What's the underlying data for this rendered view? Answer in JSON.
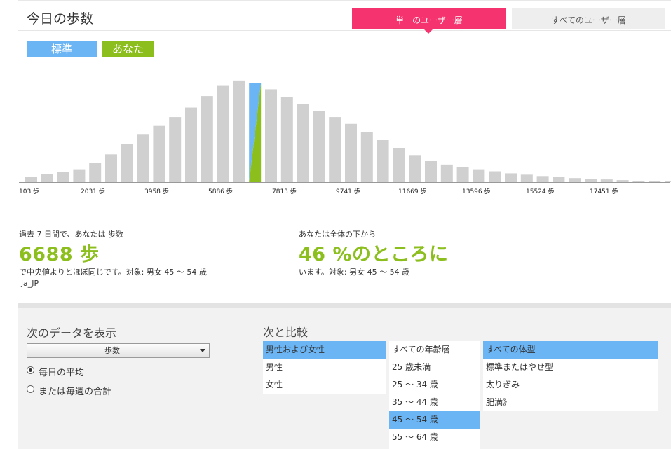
{
  "header": {
    "title": "今日の歩数",
    "tabs": [
      {
        "label": "単一のユーザー層",
        "active": true
      },
      {
        "label": "すべてのユーザー層",
        "active": false
      }
    ]
  },
  "legend": {
    "standard": "標準",
    "you": "あなた"
  },
  "colors": {
    "accent_pink": "#f5336e",
    "standard_blue": "#6bb5f5",
    "you_green": "#8cbf1e",
    "bar_gray": "#d0d0d0"
  },
  "chart_data": {
    "type": "bar",
    "title": "",
    "xlabel": "",
    "ylabel": "",
    "x_ticks": [
      "103 歩",
      "2031 歩",
      "3958 歩",
      "5886 歩",
      "7813 歩",
      "9741 歩",
      "11669 歩",
      "13596 歩",
      "15524 歩",
      "17451 歩"
    ],
    "values": [
      8,
      12,
      15,
      19,
      28,
      41,
      56,
      70,
      83,
      96,
      110,
      127,
      142,
      150,
      146,
      137,
      126,
      115,
      105,
      96,
      86,
      74,
      62,
      50,
      40,
      31,
      26,
      22,
      19,
      16,
      13,
      11,
      9,
      8,
      6,
      5,
      4,
      3,
      2,
      2,
      1
    ],
    "highlight_index": 14,
    "ylim": [
      0,
      155
    ]
  },
  "stats": {
    "left": {
      "label": "過去 7 日間で、あなたは 歩数",
      "value": "6688 歩",
      "note": "で中央値よりとほぼ同じです。対象: 男女 45 ～ 54 歳",
      "locale": "ja_JP"
    },
    "right": {
      "label": "あなたは全体の下から",
      "value": "46 %のところに",
      "note": "います。対象: 男女 45 ～ 54 歳"
    }
  },
  "display_panel": {
    "title": "次のデータを表示",
    "metric_selected": "歩数",
    "radio_options": [
      {
        "label": "毎日の平均",
        "checked": true
      },
      {
        "label": "または毎週の合計",
        "checked": false
      }
    ]
  },
  "compare_panel": {
    "title": "次と比較",
    "gender": [
      {
        "label": "男性および女性",
        "selected": true
      },
      {
        "label": "男性",
        "selected": false
      },
      {
        "label": "女性",
        "selected": false
      }
    ],
    "age": [
      {
        "label": "すべての年齢層",
        "selected": false
      },
      {
        "label": "25 歳未満",
        "selected": false
      },
      {
        "label": "25 ～ 34 歳",
        "selected": false
      },
      {
        "label": "35 ～ 44 歳",
        "selected": false
      },
      {
        "label": "45 ～ 54 歳",
        "selected": true
      },
      {
        "label": "55 ～ 64 歳",
        "selected": false
      }
    ],
    "body_type": [
      {
        "label": "すべての体型",
        "selected": true
      },
      {
        "label": "標準またはやせ型",
        "selected": false
      },
      {
        "label": "太りぎみ",
        "selected": false
      },
      {
        "label": "肥満》",
        "selected": false
      }
    ]
  }
}
